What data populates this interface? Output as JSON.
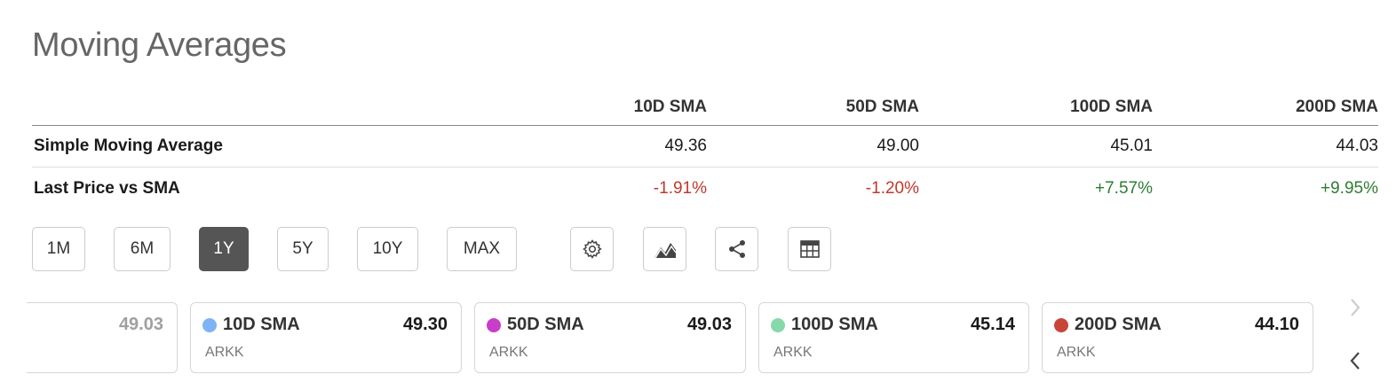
{
  "title": "Moving Averages",
  "table": {
    "headers": [
      "10D SMA",
      "50D SMA",
      "100D SMA",
      "200D SMA"
    ],
    "rows": [
      {
        "label": "Simple Moving Average",
        "values": [
          "49.36",
          "49.00",
          "45.01",
          "44.03"
        ]
      },
      {
        "label": "Last Price vs SMA",
        "values": [
          "-1.91%",
          "-1.20%",
          "+7.57%",
          "+9.95%"
        ]
      }
    ]
  },
  "ranges": [
    "1M",
    "6M",
    "1Y",
    "5Y",
    "10Y",
    "MAX"
  ],
  "active_range": "1Y",
  "tools": [
    "gear-icon",
    "chart-type-icon",
    "share-icon",
    "table-icon"
  ],
  "cards": {
    "partial_value": "49.03",
    "items": [
      {
        "name": "10D SMA",
        "value": "49.30",
        "symbol": "ARKK",
        "color": "#7fb3f5"
      },
      {
        "name": "50D SMA",
        "value": "49.03",
        "symbol": "ARKK",
        "color": "#c73ec8"
      },
      {
        "name": "100D SMA",
        "value": "45.14",
        "symbol": "ARKK",
        "color": "#86d9a8"
      },
      {
        "name": "200D SMA",
        "value": "44.10",
        "symbol": "ARKK",
        "color": "#c8453a"
      }
    ]
  },
  "colors": {
    "negative": "#c0392b",
    "positive": "#2e7d32",
    "active_button": "#555555"
  }
}
